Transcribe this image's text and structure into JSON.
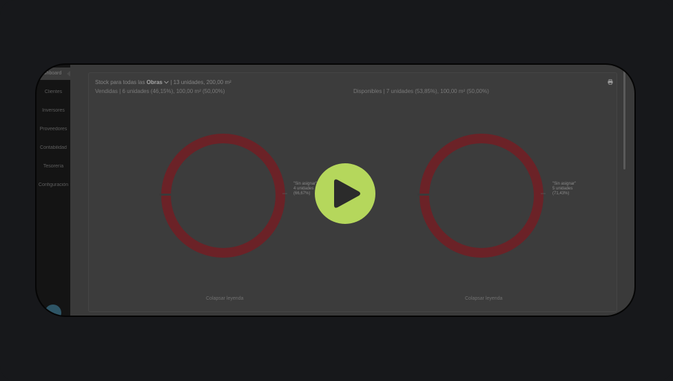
{
  "sidebar": {
    "items": [
      {
        "label": "Dashboard",
        "active": true
      },
      {
        "label": "Clientes"
      },
      {
        "label": "Inversores"
      },
      {
        "label": "Proveedores"
      },
      {
        "label": "Contabilidad"
      },
      {
        "label": "Tesorería"
      },
      {
        "label": "Configuración"
      }
    ]
  },
  "header": {
    "title_prefix": "Stock para todas las",
    "title_selector": "Obras",
    "title_suffix": "| 13 unidades, 200,00 m²"
  },
  "charts": {
    "sold_summary": "Vendidas | 6 unidades (46,15%), 100,00 m² (50,00%)",
    "available_summary": "Disponibles | 7 unidades (53,85%), 100,00 m² (50,00%)",
    "collapse_label": "Colapsar leyenda"
  },
  "chart_data": [
    {
      "type": "pie",
      "title": "Vendidas | 6 unidades (46,15%), 100,00 m² (50,00%)",
      "slices": [
        {
          "label": "\"Sin asignar\"",
          "units": 4,
          "percent": 66.67
        }
      ],
      "legend": [
        "\"Sin asignar\"",
        "4 unidades",
        "(66,67%)"
      ]
    },
    {
      "type": "pie",
      "title": "Disponibles | 7 unidades (53,85%), 100,00 m² (50,00%)",
      "slices": [
        {
          "label": "\"Sin asignar\"",
          "units": 5,
          "percent": 71.43
        }
      ],
      "legend": [
        "\"Sin asignar\"",
        "5 unidades",
        "(71,43%)"
      ]
    }
  ],
  "colors": {
    "ring": "#6b2227",
    "play": "#b5d75c",
    "background": "#17181b"
  },
  "icons": {
    "print": "printer-icon",
    "play": "play-icon",
    "dropdown": "chevron-down-icon"
  }
}
